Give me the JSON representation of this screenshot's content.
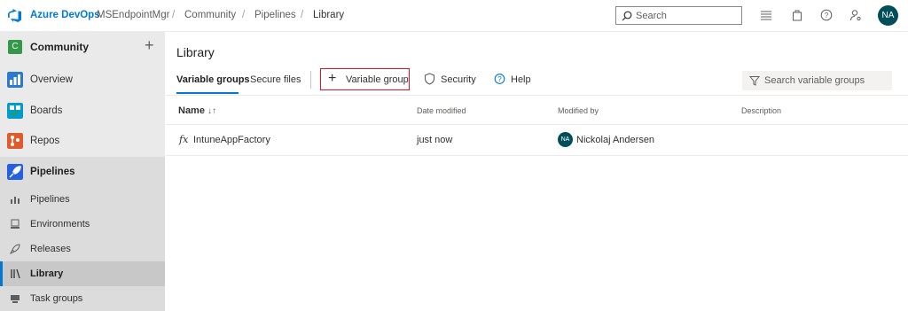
{
  "topbar": {
    "brand": "Azure DevOps",
    "breadcrumbs": [
      "MSEndpointMgr",
      "Community",
      "Pipelines",
      "Library"
    ],
    "search_placeholder": "Search",
    "user_initials": "NA"
  },
  "sidebar": {
    "project_initial": "C",
    "project_name": "Community",
    "items": [
      {
        "label": "Overview",
        "icon": "overview-icon",
        "color": "#2b79d0"
      },
      {
        "label": "Boards",
        "icon": "boards-icon",
        "color": "#009ccc"
      },
      {
        "label": "Repos",
        "icon": "repos-icon",
        "color": "#e05b2b"
      },
      {
        "label": "Pipelines",
        "icon": "pipelines-icon",
        "color": "#2560e0"
      }
    ],
    "subitems": [
      {
        "label": "Pipelines",
        "icon": "pipelines-sub-icon"
      },
      {
        "label": "Environments",
        "icon": "environments-icon"
      },
      {
        "label": "Releases",
        "icon": "releases-icon"
      },
      {
        "label": "Library",
        "icon": "library-icon"
      },
      {
        "label": "Task groups",
        "icon": "task-groups-icon"
      }
    ]
  },
  "main": {
    "title": "Library",
    "tabs": [
      "Variable groups",
      "Secure files"
    ],
    "actions": {
      "add_variable_group": "Variable group",
      "security": "Security",
      "help": "Help"
    },
    "filter_placeholder": "Search variable groups",
    "columns": [
      "Name",
      "Date modified",
      "Modified by",
      "Description"
    ],
    "rows": [
      {
        "icon_text": "fx",
        "name": "IntuneAppFactory",
        "date_modified": "just now",
        "modified_by_initials": "NA",
        "modified_by": "Nickolaj Andersen",
        "description": ""
      }
    ]
  },
  "colors": {
    "accent": "#0078d4",
    "highlight_border": "#e81123",
    "project_badge": "#339947",
    "avatar": "#004e5a"
  }
}
